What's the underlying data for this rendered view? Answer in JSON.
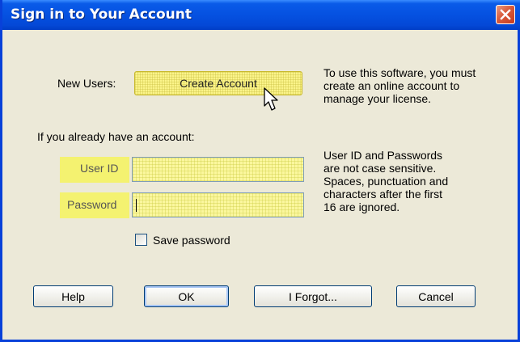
{
  "window": {
    "title": "Sign in to Your Account"
  },
  "new_users": {
    "label": "New Users:",
    "create_button": "Create Account",
    "help": "To use this software, you must\ncreate an online account to\nmanage your license."
  },
  "existing": {
    "heading": "If you already have an account:",
    "user_id_label": "User ID",
    "user_id_value": "",
    "password_label": "Password",
    "password_value": "",
    "help": "User ID and Passwords\nare not case sensitive.\nSpaces, punctuation and\ncharacters after the first\n16 are ignored."
  },
  "save_password": {
    "label": "Save password",
    "checked": false
  },
  "buttons": {
    "help": "Help",
    "ok": "OK",
    "forgot": "I Forgot...",
    "cancel": "Cancel"
  },
  "colors": {
    "title_bar": "#0551E1",
    "highlight": "#F4F270",
    "dialog_bg": "#ECE9D8",
    "close": "#D95B3B"
  },
  "icons": {
    "close": "close-icon",
    "cursor": "mouse-pointer-icon"
  }
}
